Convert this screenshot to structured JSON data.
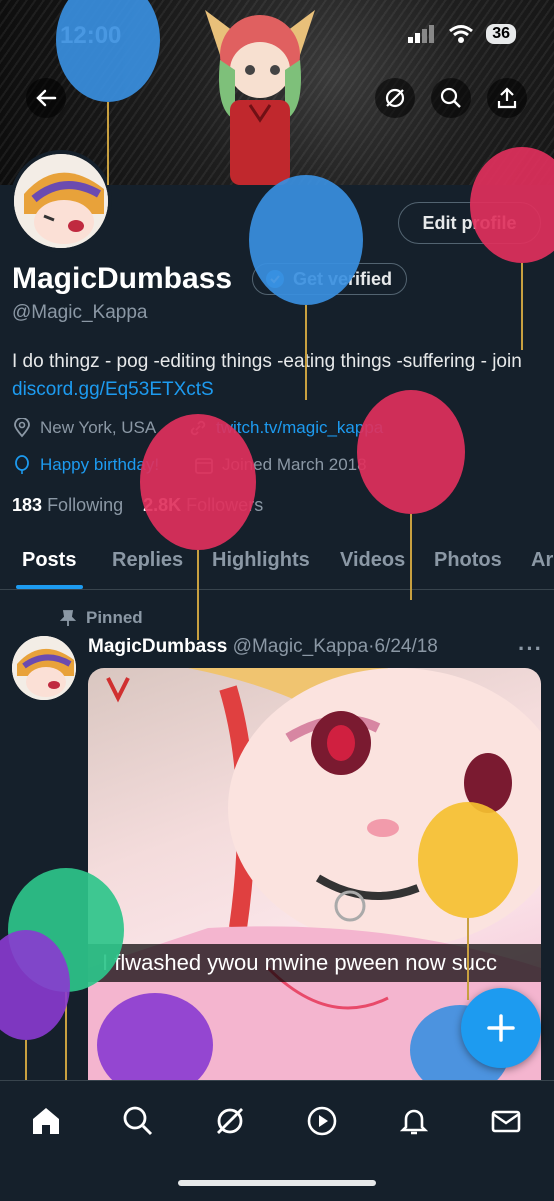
{
  "status_bar": {
    "time": "12:00",
    "battery": "36"
  },
  "profile": {
    "display_name": "MagicDumbass",
    "handle": "@Magic_Kappa",
    "edit_button": "Edit profile",
    "verify_button": "Get verified",
    "bio_text": "I do thingz - pog -editing things -eating things -suffering - join ",
    "bio_link": "discord.gg/Eq53ETXctS",
    "location": "New York, USA",
    "website": "twitch.tv/magic_kappa",
    "birthday": "Happy birthday!",
    "joined": "Joined March 2018",
    "following_count": "183",
    "following_label": "Following",
    "followers_count": "2.8K",
    "followers_label": "Followers"
  },
  "tabs": [
    {
      "label": "Posts",
      "active": true
    },
    {
      "label": "Replies",
      "active": false
    },
    {
      "label": "Highlights",
      "active": false
    },
    {
      "label": "Videos",
      "active": false
    },
    {
      "label": "Photos",
      "active": false
    },
    {
      "label": "Ar",
      "active": false
    }
  ],
  "tweet": {
    "pinned_label": "Pinned",
    "author": "MagicDumbass",
    "handle": "@Magic_Kappa",
    "separator": "·",
    "date": "6/24/18",
    "more": "···",
    "caption": "I flwashed ywou mwine pween now succ"
  },
  "colors": {
    "accent": "#1d9bf0",
    "background": "#15202b",
    "muted": "#8b98a5",
    "text": "#e7e9ea"
  },
  "icons": {
    "back": "arrow-left-icon",
    "grok": "grok-icon",
    "search": "search-icon",
    "share": "share-icon",
    "verified": "verified-badge-icon",
    "location": "location-pin-icon",
    "link": "link-icon",
    "birthday": "balloon-icon",
    "calendar": "calendar-icon",
    "pin": "pin-icon",
    "home": "home-icon",
    "explore": "search-icon",
    "play": "play-icon",
    "bell": "bell-icon",
    "mail": "mail-icon",
    "compose": "plus-icon"
  }
}
